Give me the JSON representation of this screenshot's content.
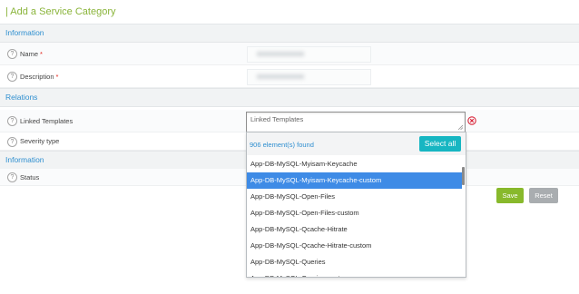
{
  "page": {
    "title": "| Add a Service Category"
  },
  "sections": {
    "information": "Information",
    "relations": "Relations",
    "information2": "Information"
  },
  "fields": {
    "name": {
      "label": "Name",
      "required_mark": "*"
    },
    "description": {
      "label": "Description",
      "required_mark": "*"
    },
    "linked_templates": {
      "label": "Linked Templates",
      "placeholder": "Linked Templates"
    },
    "severity_type": {
      "label": "Severity type"
    },
    "status": {
      "label": "Status"
    }
  },
  "help_glyph": "?",
  "dropdown": {
    "count_text": "906 element(s) found",
    "select_all_label": "Select all",
    "options": [
      {
        "label": "App-DB-MySQL-Myisam-Keycache",
        "selected": false
      },
      {
        "label": "App-DB-MySQL-Myisam-Keycache-custom",
        "selected": true
      },
      {
        "label": "App-DB-MySQL-Open-Files",
        "selected": false
      },
      {
        "label": "App-DB-MySQL-Open-Files-custom",
        "selected": false
      },
      {
        "label": "App-DB-MySQL-Qcache-Hitrate",
        "selected": false
      },
      {
        "label": "App-DB-MySQL-Qcache-Hitrate-custom",
        "selected": false
      },
      {
        "label": "App-DB-MySQL-Queries",
        "selected": false
      },
      {
        "label": "App-DB-MySQL-Queries-custom",
        "selected": false
      }
    ]
  },
  "buttons": {
    "save": "Save",
    "reset": "Reset"
  },
  "colors": {
    "title": "#8ab43a",
    "section_text": "#2f8fd0",
    "select_all": "#17b6c2",
    "selected_option": "#3e8be6",
    "save": "#88b92c",
    "reset": "#a9adb0",
    "clear_icon": "#d9263a"
  },
  "icons": {
    "help": "question-circle-icon",
    "clear": "remove-circle-icon",
    "resize": "resize-grip-icon"
  }
}
